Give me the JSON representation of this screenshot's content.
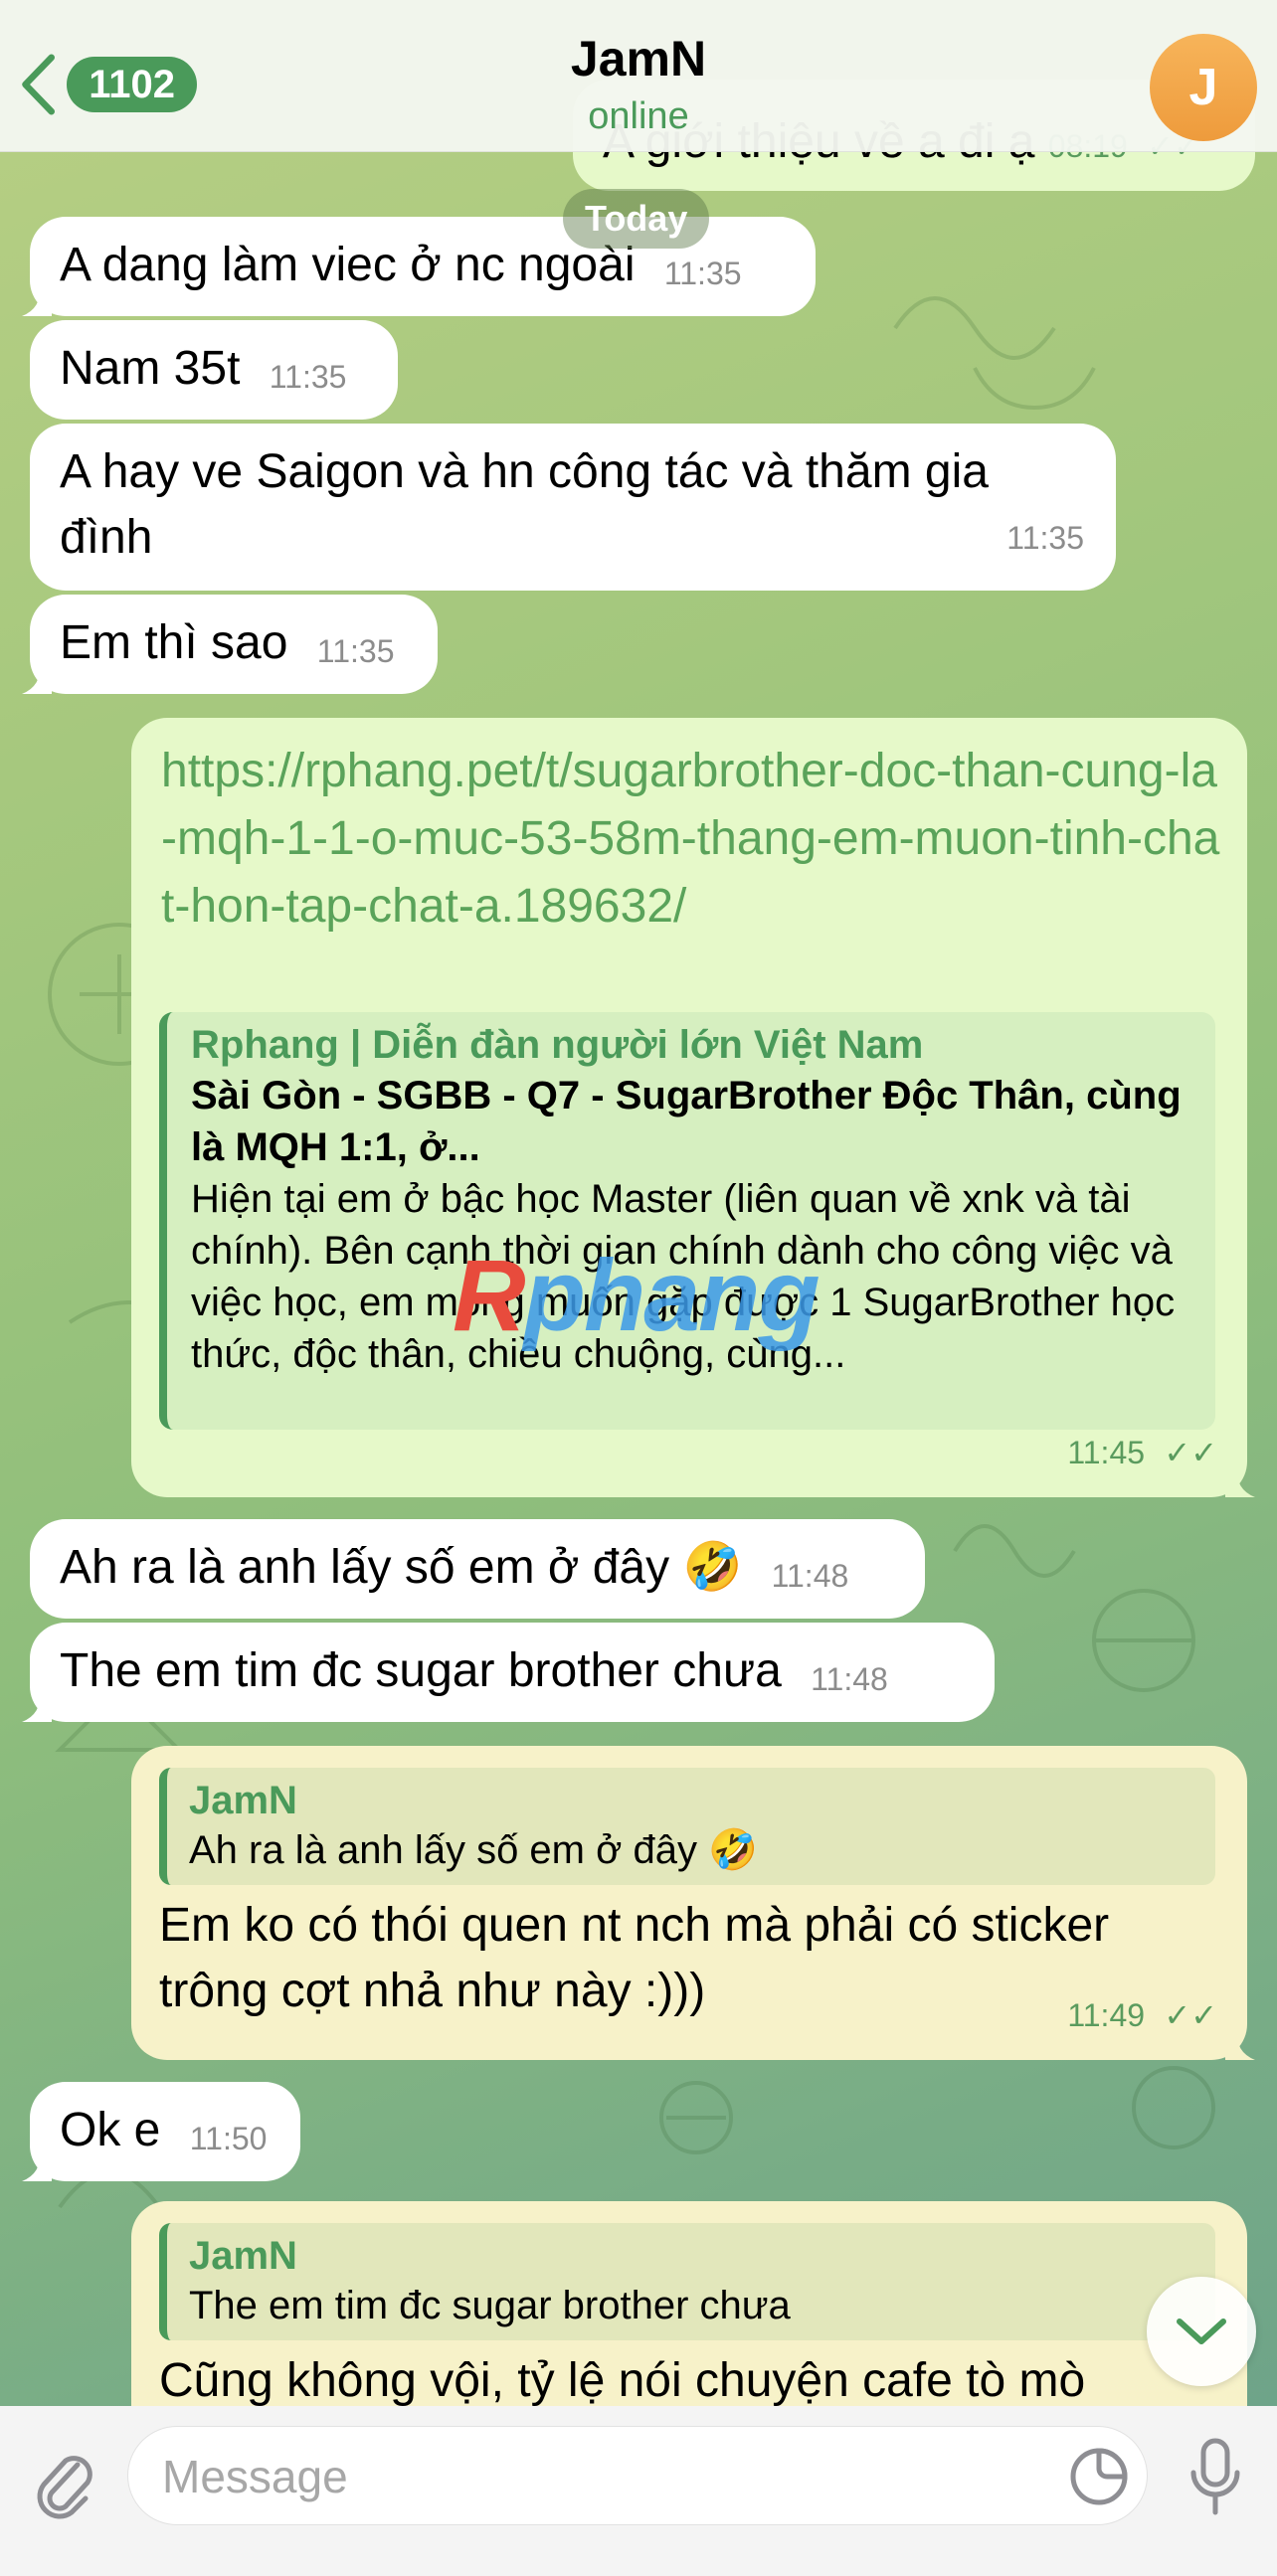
{
  "header": {
    "back_count": "1102",
    "title": "JamN",
    "status": "online",
    "avatar_initial": "J"
  },
  "date_badge": "Today",
  "messages": {
    "m0_partial": {
      "text": "A giới thiệu về a đi ạ",
      "time": "08:19"
    },
    "m1": {
      "text": "A dang làm viec ở nc ngoài",
      "time": "11:35"
    },
    "m2": {
      "text": "Nam 35t",
      "time": "11:35"
    },
    "m3": {
      "text": "A hay ve Saigon và hn công tác và thăm gia đình",
      "time": "11:35"
    },
    "m4": {
      "text": "Em thì sao",
      "time": "11:35"
    },
    "m5": {
      "link": "https://rphang.pet/t/sugarbrother-doc-than-cung-la-mqh-1-1-o-muc-53-58m-thang-em-muon-tinh-chat-hon-tap-chat-a.189632/",
      "preview_site": "Rphang | Diễn đàn người lớn Việt Nam",
      "preview_title": "Sài Gòn - SGBB - Q7 - SugarBrother Độc Thân, cùng là MQH 1:1, ở...",
      "preview_desc": "Hiện tại em ở bậc học Master (liên quan về xnk và tài chính). Bên cạnh thời gian chính dành cho công việc và việc học, em mong muốn gặp được 1 SugarBrother học thức, độc thân, chiều chuộng, cùng...",
      "time": "11:45"
    },
    "m6": {
      "text": "Ah ra là anh lấy số em ở đây 🤣",
      "time": "11:48"
    },
    "m7": {
      "text": "The em tim đc sugar brother chưa",
      "time": "11:48"
    },
    "m8": {
      "reply_name": "JamN",
      "reply_text": "Ah ra là anh lấy số em ở đây 🤣",
      "text": "Em ko có thói quen nt nch mà phải có sticker trông cợt nhả như này :)))",
      "time": "11:49"
    },
    "m9": {
      "text": "Ok e",
      "time": "11:50"
    },
    "m10": {
      "reply_name": "JamN",
      "reply_text": "The em tim đc sugar brother chưa",
      "text_partial": "Cũng không vội, tỷ lệ nói chuyện cafe tò mò"
    }
  },
  "watermark": {
    "first": "R",
    "rest": "phang"
  },
  "input": {
    "placeholder": "Message"
  },
  "icons": {
    "back": "chevron-left-icon",
    "attach": "paperclip-icon",
    "sticker": "sticker-icon",
    "mic": "microphone-icon",
    "scroll": "chevron-down-icon",
    "read": "double-check-icon"
  },
  "colors": {
    "accent": "#4a9a5a",
    "outgoing": "#e6f9c9",
    "incoming": "#ffffff"
  }
}
